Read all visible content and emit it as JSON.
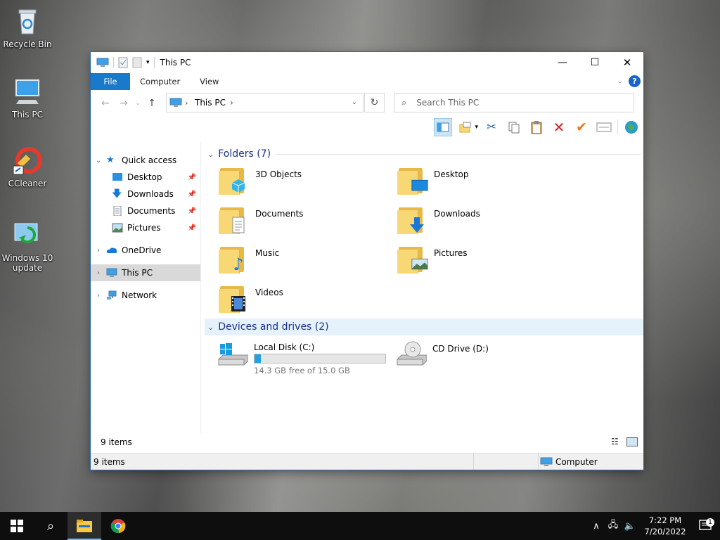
{
  "desktop": {
    "icons": [
      {
        "label": "Recycle Bin",
        "icon": "recycle-bin-icon"
      },
      {
        "label": "This PC",
        "icon": "computer-icon"
      },
      {
        "label": "CCleaner",
        "icon": "ccleaner-icon"
      },
      {
        "label": "Windows 10 update",
        "icon": "windows-update-icon"
      }
    ]
  },
  "window": {
    "title": "This PC",
    "controls": {
      "minimize": "—",
      "maximize": "☐",
      "close": "✕"
    },
    "ribbon": {
      "tabs": [
        {
          "label": "File",
          "active": true
        },
        {
          "label": "Computer"
        },
        {
          "label": "View"
        }
      ],
      "help": "?"
    },
    "address": {
      "crumb": "This PC",
      "separator": "›"
    },
    "search": {
      "placeholder": "Search This PC"
    },
    "nav": {
      "quick_access": "Quick access",
      "quick_items": [
        {
          "label": "Desktop"
        },
        {
          "label": "Downloads"
        },
        {
          "label": "Documents"
        },
        {
          "label": "Pictures"
        }
      ],
      "onedrive": "OneDrive",
      "this_pc": "This PC",
      "network": "Network"
    },
    "folders": {
      "header": "Folders (7)",
      "items": [
        {
          "label": "3D Objects",
          "icon": "3d-objects-icon"
        },
        {
          "label": "Desktop",
          "icon": "desktop-folder-icon"
        },
        {
          "label": "Documents",
          "icon": "documents-folder-icon"
        },
        {
          "label": "Downloads",
          "icon": "downloads-folder-icon"
        },
        {
          "label": "Music",
          "icon": "music-folder-icon"
        },
        {
          "label": "Pictures",
          "icon": "pictures-folder-icon"
        },
        {
          "label": "Videos",
          "icon": "videos-folder-icon"
        }
      ]
    },
    "drives": {
      "header": "Devices and drives (2)",
      "local": {
        "label": "Local Disk (C:)",
        "free": "14.3 GB free of 15.0 GB",
        "used_fraction": 0.047
      },
      "cd": {
        "label": "CD Drive (D:)"
      }
    },
    "status": {
      "items": "9 items"
    },
    "details": {
      "items": "9 items",
      "location": "Computer"
    }
  },
  "taskbar": {
    "time": "7:22 PM",
    "date": "7/20/2022",
    "notification_count": "1"
  },
  "colors": {
    "accent": "#1979ca",
    "selection": "#d9d9d9",
    "drive_bar": "#26a0da",
    "taskbar": "#0e0e0e"
  }
}
